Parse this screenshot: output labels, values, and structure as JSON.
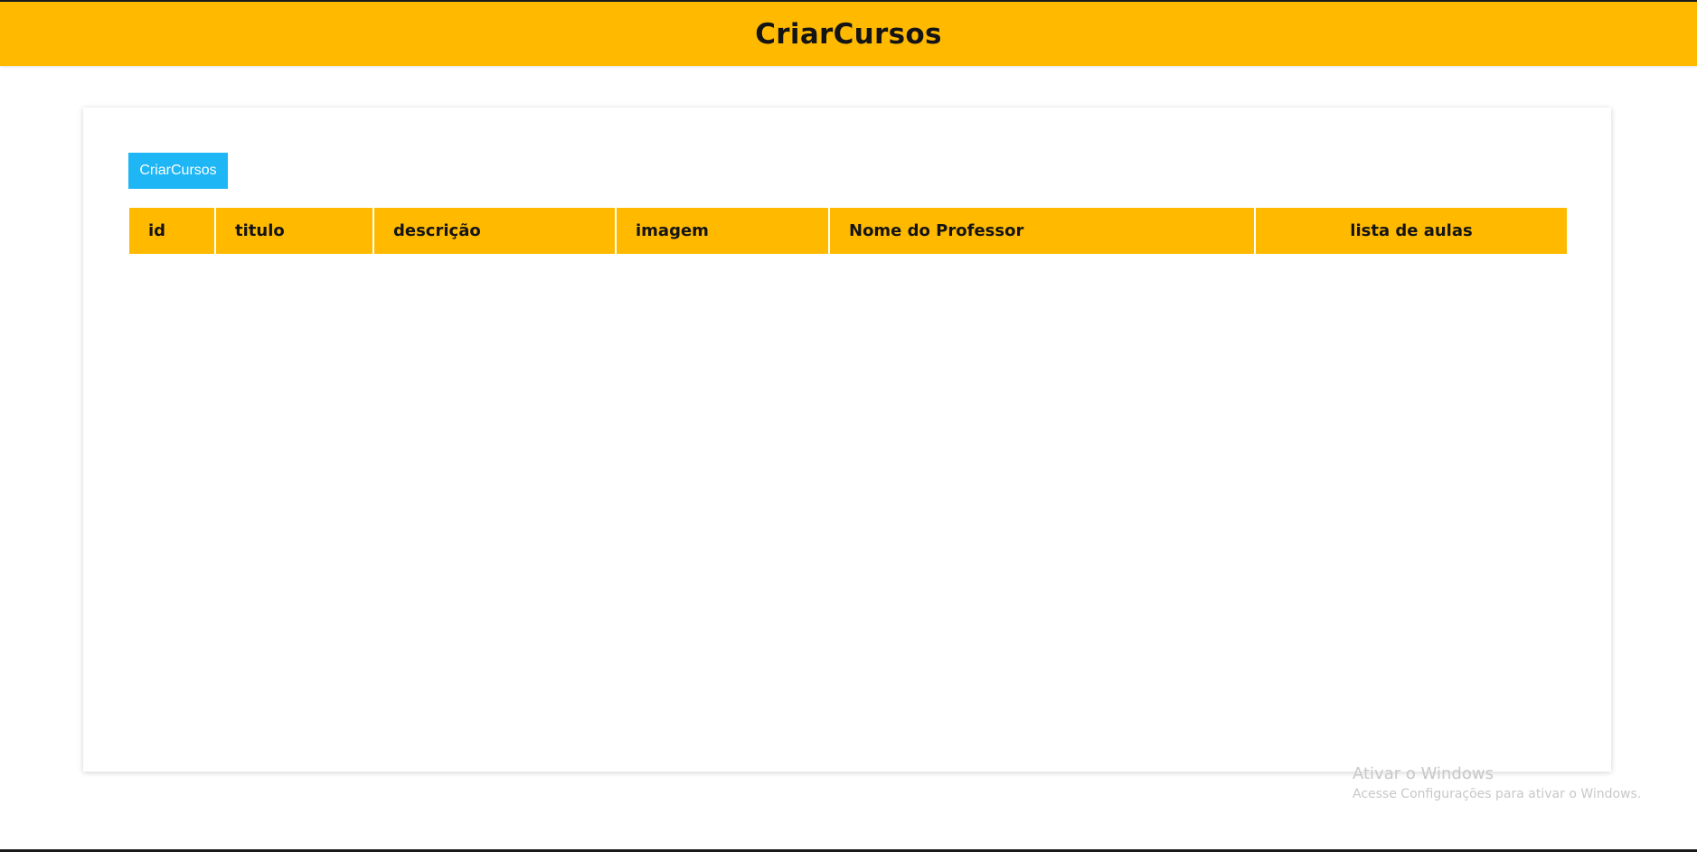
{
  "header": {
    "title": "CriarCursos"
  },
  "main": {
    "create_button_label": "CriarCursos",
    "table": {
      "columns": [
        "id",
        "titulo",
        "descrição",
        "imagem",
        "Nome do Professor",
        "lista de aulas"
      ],
      "rows": []
    }
  },
  "watermark": {
    "title": "Ativar o Windows",
    "subtitle": "Acesse Configurações para ativar o Windows."
  },
  "colors": {
    "header_bg": "#FFBA00",
    "button_bg": "#1EB6F4",
    "text_dark": "#141414"
  }
}
